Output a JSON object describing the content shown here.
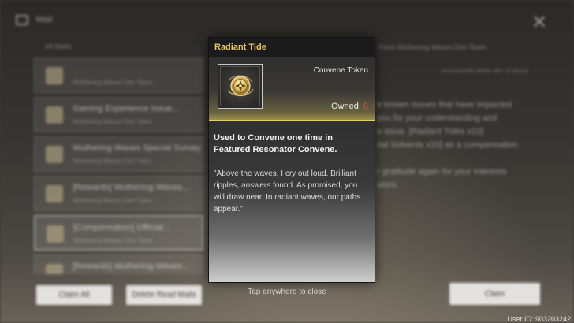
{
  "background": {
    "header": {
      "title": "Mail"
    },
    "list": {
      "header": "All Mails",
      "items": [
        {
          "title": "",
          "sender": "Wuthering Waves Dev Team"
        },
        {
          "title": "Gaming Experience Issue...",
          "sender": "Wuthering Waves Dev Team"
        },
        {
          "title": "Wuthering Waves Special Survey",
          "sender": "Wuthering Waves Dev Team"
        },
        {
          "title": "[Rewards] Wuthering Waves...",
          "sender": "Wuthering Waves Dev Team"
        },
        {
          "title": "[Compensation] Official...",
          "sender": "Wuthering Waves Dev Team"
        },
        {
          "title": "[Rewards] Wuthering Waves...",
          "sender": "Wuthering Waves Dev Team"
        }
      ]
    },
    "detail": {
      "subtitle": "From Wuthering Waves Dev Team",
      "meta": "Automatically delete after 16 day(s)",
      "lines": [
        "e known issues that have impacted",
        "you for your understanding and",
        "e issue. [Radiant Tides x10]",
        "ital Solvents x20] as a compensation",
        "",
        "r gratitude again for your interests",
        "ators."
      ]
    },
    "buttons": {
      "claim_all": "Claim All",
      "delete_read": "Delete Read Mails",
      "claim": "Claim"
    },
    "tap_hint": "Tap anywhere to close",
    "uid": "User ID: 903203242"
  },
  "item": {
    "name": "Radiant Tide",
    "type": "Convene Token",
    "owned_label": "Owned",
    "owned_count": "0",
    "usage": "Used to Convene one time in Featured Resonator Convene.",
    "flavor": "\"Above the waves, I cry out loud. Brilliant ripples, answers found. As promised, you will draw near. In radiant waves, our paths appear.\"",
    "icon": "radiant-tide-token-icon"
  },
  "colors": {
    "title_gold": "#ecc75c",
    "accent_line": "#e3cf63",
    "owned_zero_red": "#e64a3c"
  }
}
